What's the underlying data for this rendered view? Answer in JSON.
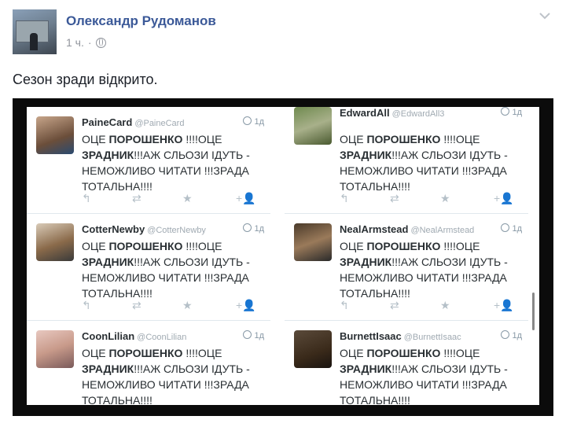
{
  "post": {
    "author": "Олександр Рудоманов",
    "time": "1 ч.",
    "separator": "·",
    "text": "Сезон зради відкрито."
  },
  "tweets": [
    {
      "name": "PaineCard",
      "handle": "@PaineCard",
      "time": "1д",
      "line1a": "ОЦЕ ",
      "bold1": "ПОРОШЕНКО",
      "line1b": " !!!!ОЦЕ",
      "bold2": "ЗРАДНИК",
      "line2b": "!!!АЖ СЛЬОЗИ ІДУТЬ -",
      "line3": "НЕМОЖЛИВО ЧИТАТИ !!!ЗРАДА",
      "line4": "ТОТАЛЬНА!!!!"
    },
    {
      "name": "EdwardAll",
      "handle": "@EdwardAll3",
      "time": "1д",
      "line1a": "ОЦЕ ",
      "bold1": "ПОРОШЕНКО",
      "line1b": " !!!!ОЦЕ",
      "bold2": "ЗРАДНИК",
      "line2b": "!!!АЖ СЛЬОЗИ ІДУТЬ -",
      "line3": "НЕМОЖЛИВО ЧИТАТИ !!!ЗРАДА",
      "line4": "ТОТАЛЬНА!!!!"
    },
    {
      "name": "CotterNewby",
      "handle": "@CotterNewby",
      "time": "1д",
      "line1a": "ОЦЕ ",
      "bold1": "ПОРОШЕНКО",
      "line1b": " !!!!ОЦЕ",
      "bold2": "ЗРАДНИК",
      "line2b": "!!!АЖ СЛЬОЗИ ІДУТЬ -",
      "line3": "НЕМОЖЛИВО ЧИТАТИ !!!ЗРАДА",
      "line4": "ТОТАЛЬНА!!!!"
    },
    {
      "name": "NealArmstead",
      "handle": "@NealArmstead",
      "time": "1д",
      "line1a": "ОЦЕ ",
      "bold1": "ПОРОШЕНКО",
      "line1b": " !!!!ОЦЕ",
      "bold2": "ЗРАДНИК",
      "line2b": "!!!АЖ СЛЬОЗИ ІДУТЬ -",
      "line3": "НЕМОЖЛИВО ЧИТАТИ !!!ЗРАДА",
      "line4": "ТОТАЛЬНА!!!!"
    },
    {
      "name": "CoonLilian",
      "handle": "@CoonLilian",
      "time": "1д",
      "line1a": "ОЦЕ ",
      "bold1": "ПОРОШЕНКО",
      "line1b": " !!!!ОЦЕ",
      "bold2": "ЗРАДНИК",
      "line2b": "!!!АЖ СЛЬОЗИ ІДУТЬ -",
      "line3": "НЕМОЖЛИВО ЧИТАТИ !!!ЗРАДА",
      "line4": "ТОТАЛЬНА!!!!"
    },
    {
      "name": "BurnettIsaac",
      "handle": "@BurnettIsaac",
      "time": "1д",
      "line1a": "ОЦЕ ",
      "bold1": "ПОРОШЕНКО",
      "line1b": " !!!!ОЦЕ",
      "bold2": "ЗРАДНИК",
      "line2b": "!!!АЖ СЛЬОЗИ ІДУТЬ -",
      "line3": "НЕМОЖЛИВО ЧИТАТИ !!!ЗРАДА",
      "line4": "ТОТАЛЬНА!!!!"
    }
  ],
  "icons": {
    "reply": "reply-icon",
    "retweet": "retweet-icon",
    "favorite": "star-icon",
    "follow": "follow-icon"
  },
  "colors": {
    "author": "#3b5998",
    "meta": "#90949c"
  }
}
